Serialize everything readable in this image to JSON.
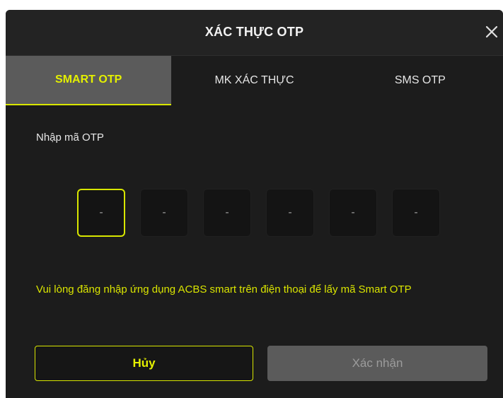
{
  "dialog": {
    "title": "XÁC THỰC OTP",
    "close_icon": "close-icon"
  },
  "tabs": [
    {
      "label": "SMART OTP",
      "active": true
    },
    {
      "label": "MK XÁC THỰC",
      "active": false
    },
    {
      "label": "SMS OTP",
      "active": false
    }
  ],
  "otp": {
    "label": "Nhập mã OTP",
    "digits": [
      "-",
      "-",
      "-",
      "-",
      "-",
      "-"
    ],
    "focused_index": 0
  },
  "hint": "Vui lòng đăng nhập ứng dụng ACBS smart trên điện thoại để lấy mã Smart OTP",
  "buttons": {
    "cancel_label": "Hủy",
    "confirm_label": "Xác nhận"
  },
  "colors": {
    "accent": "#d8e600",
    "background": "#1c1c1c",
    "active_tab": "#5b5b5b",
    "disabled_button": "#5b5b5b"
  }
}
